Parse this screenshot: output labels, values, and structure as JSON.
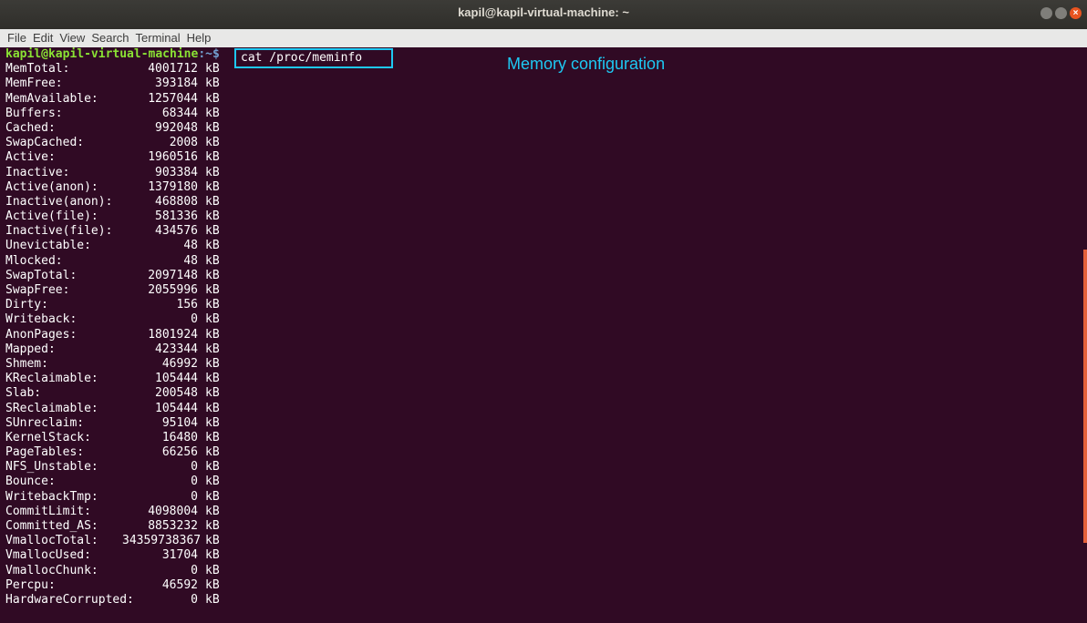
{
  "window": {
    "title": "kapil@kapil-virtual-machine: ~"
  },
  "menu": [
    "File",
    "Edit",
    "View",
    "Search",
    "Terminal",
    "Help"
  ],
  "prompt": {
    "user": "kapil@kapil-virtual-machine",
    "path": ":~$"
  },
  "command": "cat /proc/meminfo",
  "annotation": "Memory configuration",
  "meminfo": [
    {
      "key": "MemTotal:",
      "value": "4001712",
      "unit": "kB"
    },
    {
      "key": "MemFree:",
      "value": "393184",
      "unit": "kB"
    },
    {
      "key": "MemAvailable:",
      "value": "1257044",
      "unit": "kB"
    },
    {
      "key": "Buffers:",
      "value": "68344",
      "unit": "kB"
    },
    {
      "key": "Cached:",
      "value": "992048",
      "unit": "kB"
    },
    {
      "key": "SwapCached:",
      "value": "2008",
      "unit": "kB"
    },
    {
      "key": "Active:",
      "value": "1960516",
      "unit": "kB"
    },
    {
      "key": "Inactive:",
      "value": "903384",
      "unit": "kB"
    },
    {
      "key": "Active(anon):",
      "value": "1379180",
      "unit": "kB"
    },
    {
      "key": "Inactive(anon):",
      "value": "468808",
      "unit": "kB"
    },
    {
      "key": "Active(file):",
      "value": "581336",
      "unit": "kB"
    },
    {
      "key": "Inactive(file):",
      "value": "434576",
      "unit": "kB"
    },
    {
      "key": "Unevictable:",
      "value": "48",
      "unit": "kB"
    },
    {
      "key": "Mlocked:",
      "value": "48",
      "unit": "kB"
    },
    {
      "key": "SwapTotal:",
      "value": "2097148",
      "unit": "kB"
    },
    {
      "key": "SwapFree:",
      "value": "2055996",
      "unit": "kB"
    },
    {
      "key": "Dirty:",
      "value": "156",
      "unit": "kB"
    },
    {
      "key": "Writeback:",
      "value": "0",
      "unit": "kB"
    },
    {
      "key": "AnonPages:",
      "value": "1801924",
      "unit": "kB"
    },
    {
      "key": "Mapped:",
      "value": "423344",
      "unit": "kB"
    },
    {
      "key": "Shmem:",
      "value": "46992",
      "unit": "kB"
    },
    {
      "key": "KReclaimable:",
      "value": "105444",
      "unit": "kB"
    },
    {
      "key": "Slab:",
      "value": "200548",
      "unit": "kB"
    },
    {
      "key": "SReclaimable:",
      "value": "105444",
      "unit": "kB"
    },
    {
      "key": "SUnreclaim:",
      "value": "95104",
      "unit": "kB"
    },
    {
      "key": "KernelStack:",
      "value": "16480",
      "unit": "kB"
    },
    {
      "key": "PageTables:",
      "value": "66256",
      "unit": "kB"
    },
    {
      "key": "NFS_Unstable:",
      "value": "0",
      "unit": "kB"
    },
    {
      "key": "Bounce:",
      "value": "0",
      "unit": "kB"
    },
    {
      "key": "WritebackTmp:",
      "value": "0",
      "unit": "kB"
    },
    {
      "key": "CommitLimit:",
      "value": "4098004",
      "unit": "kB"
    },
    {
      "key": "Committed_AS:",
      "value": "8853232",
      "unit": "kB"
    },
    {
      "key": "VmallocTotal:",
      "value": "34359738367",
      "unit": "kB"
    },
    {
      "key": "VmallocUsed:",
      "value": "31704",
      "unit": "kB"
    },
    {
      "key": "VmallocChunk:",
      "value": "0",
      "unit": "kB"
    },
    {
      "key": "Percpu:",
      "value": "46592",
      "unit": "kB"
    },
    {
      "key": "HardwareCorrupted:",
      "value": "0",
      "unit": "kB"
    }
  ]
}
